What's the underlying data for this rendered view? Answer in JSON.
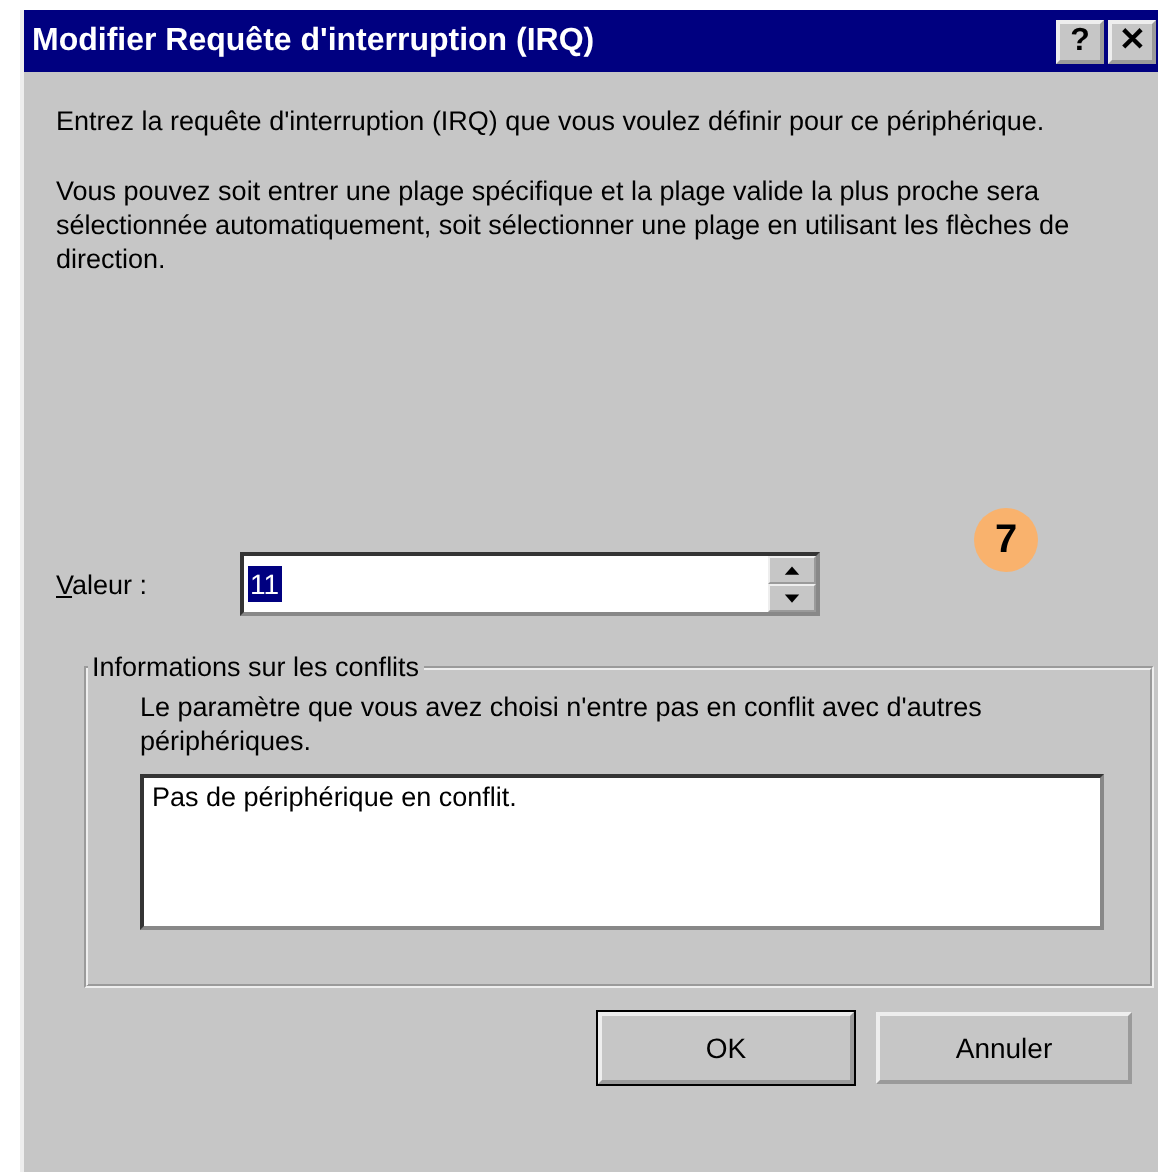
{
  "window": {
    "title": "Modifier Requête d'interruption (IRQ)",
    "title_buttons": [
      "?",
      "✕"
    ]
  },
  "paragraphs": [
    "Entrez la requête d'interruption (IRQ) que vous voulez définir pour ce périphérique.",
    "Vous pouvez soit entrer une plage spécifique et la plage valide la plus proche sera sélectionnée automatiquement, soit sélectionner une plage en utilisant les flèches de direction."
  ],
  "callout": "7",
  "value_field": {
    "label": "Valeur :",
    "value": "11",
    "value_selected": true
  },
  "conflicts": {
    "title": "Informations sur les conflits",
    "message": "Le paramètre que vous avez choisi n'entre pas en conflit avec d'autres périphériques.",
    "list_text": "Pas de périphérique en conflit."
  },
  "buttons": [
    "OK",
    "Annuler"
  ]
}
